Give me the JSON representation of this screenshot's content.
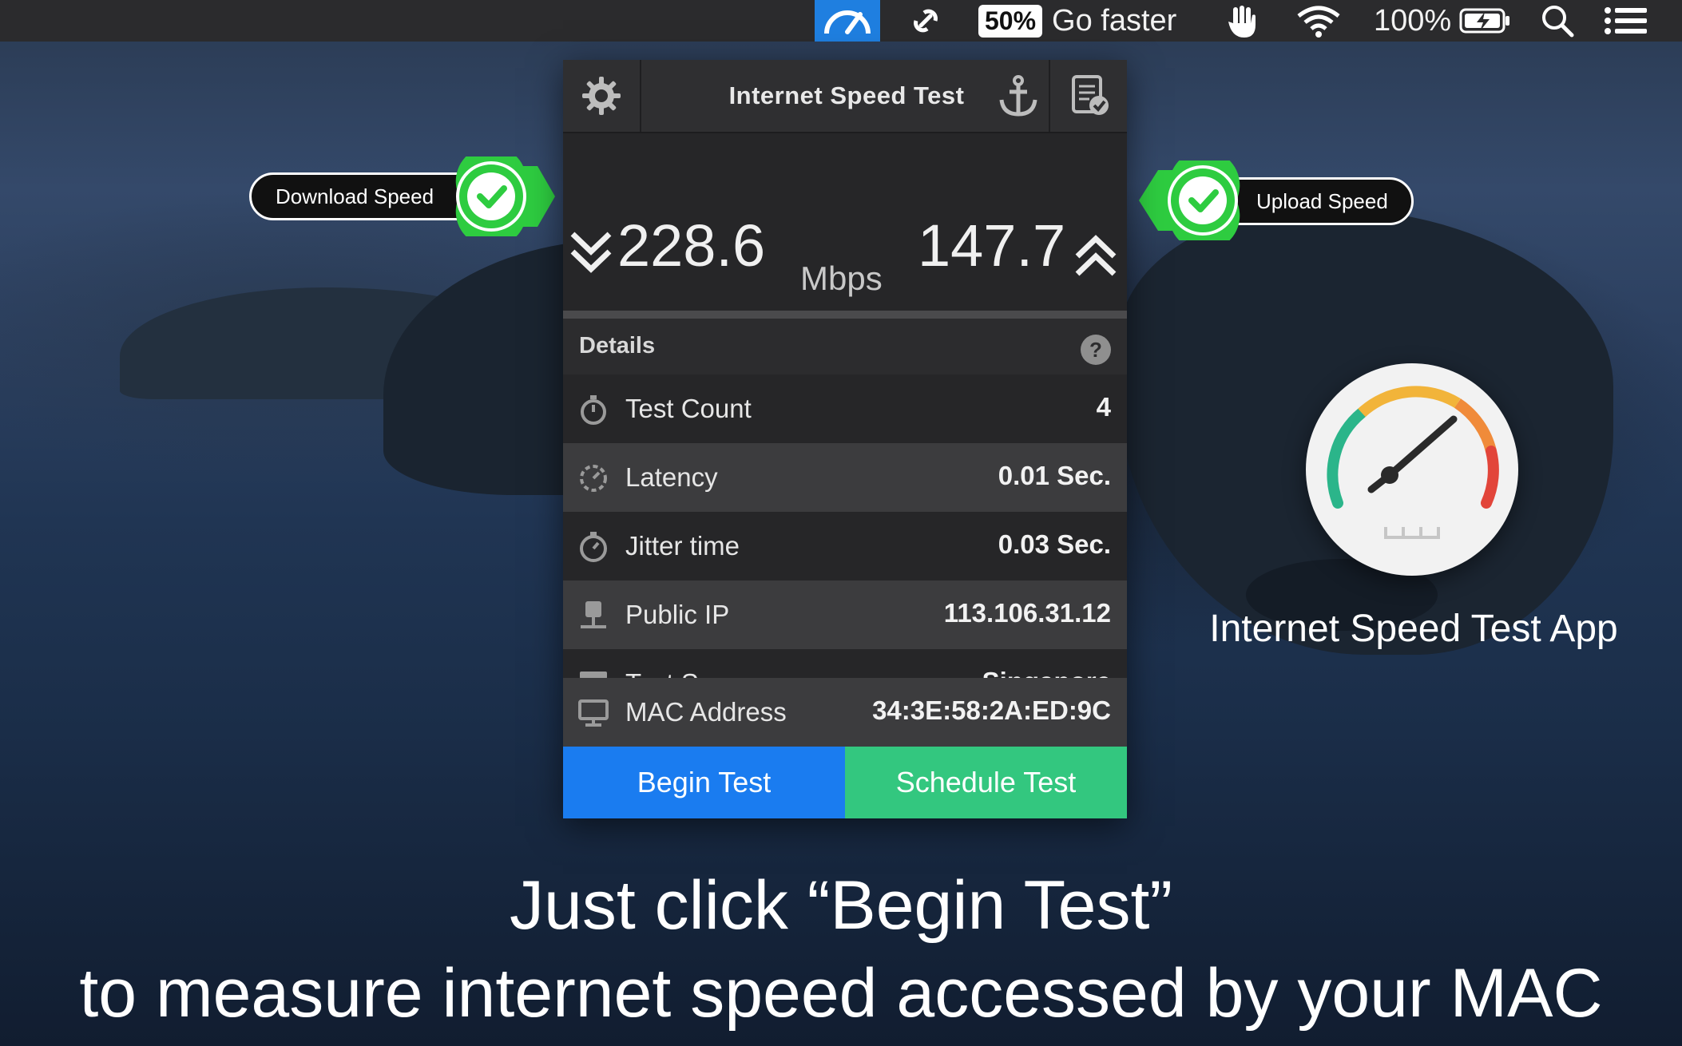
{
  "menubar": {
    "battery_badge": "50%",
    "go_faster": "Go faster",
    "battery_percent": "100%",
    "icons": [
      "speed-gauge-icon",
      "link-icon",
      "hand-icon",
      "wifi-icon",
      "battery-icon",
      "search-icon",
      "list-icon"
    ]
  },
  "widget": {
    "title": "Internet Speed Test",
    "download": "228.6",
    "unit": "Mbps",
    "upload": "147.7",
    "details_title": "Details",
    "help": "?",
    "rows": [
      {
        "label": "Test Count",
        "value": "4",
        "icon": "stopwatch-icon"
      },
      {
        "label": "Latency",
        "value": "0.01 Sec.",
        "icon": "latency-icon"
      },
      {
        "label": "Jitter time",
        "value": "0.03 Sec.",
        "icon": "timer-icon"
      },
      {
        "label": "Public IP",
        "value": "113.106.31.12",
        "icon": "ip-icon"
      },
      {
        "label": "Test Server",
        "value": "Singapore",
        "icon": "server-icon"
      },
      {
        "label": "MAC Address",
        "value": "34:3E:58:2A:ED:9C",
        "icon": "monitor-icon"
      }
    ],
    "begin_label": "Begin Test",
    "schedule_label": "Schedule Test"
  },
  "callouts": {
    "download": "Download Speed",
    "upload": "Upload Speed"
  },
  "app_name": "Internet Speed Test App",
  "caption": {
    "line1": "Just click “Begin Test”",
    "line2": "to measure internet speed accessed by your MAC"
  },
  "colors": {
    "begin": "#1a7cf0",
    "schedule": "#33c77f",
    "check": "#2ecc40",
    "menubar_active": "#1f7fe0"
  }
}
